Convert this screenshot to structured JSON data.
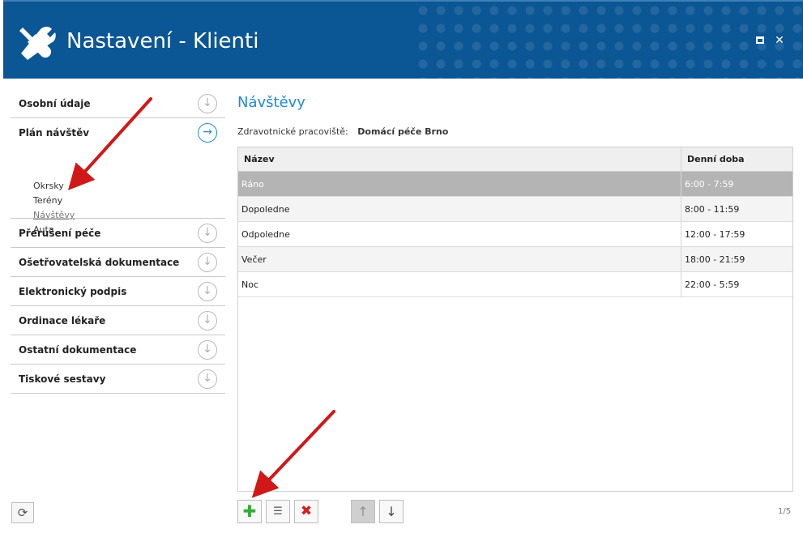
{
  "window": {
    "title": "Nastavení - Klienti"
  },
  "sidebar": {
    "sections": [
      {
        "label": "Osobní údaje"
      },
      {
        "label": "Plán návštěv",
        "subitems": [
          "Okrsky",
          "Terény",
          "Návštěvy",
          "Auta"
        ]
      },
      {
        "label": "Přerušení péče"
      },
      {
        "label": "Ošetřovatelská dokumentace"
      },
      {
        "label": "Elektronický podpis"
      },
      {
        "label": "Ordinace lékaře"
      },
      {
        "label": "Ostatní dokumentace"
      },
      {
        "label": "Tiskové sestavy"
      }
    ]
  },
  "main": {
    "title": "Návštěvy",
    "workplace_label": "Zdravotnické pracoviště:",
    "workplace_value": "Domácí péče Brno",
    "columns": [
      "Název",
      "Denní doba"
    ],
    "rows": [
      [
        "Ráno",
        "6:00 - 7:59"
      ],
      [
        "Dopoledne",
        "8:00 - 11:59"
      ],
      [
        "Odpoledne",
        "12:00 - 17:59"
      ],
      [
        "Večer",
        "18:00 - 21:59"
      ],
      [
        "Noc",
        "22:00 - 5:59"
      ]
    ],
    "pager": "1/5"
  },
  "toolbar": {
    "add_icon": "✚",
    "edit_icon": "☰",
    "delete_icon": "✖",
    "up_icon": "↑",
    "down_icon": "↓",
    "refresh_icon": "⟳"
  },
  "colors": {
    "header_bg": "#0b5694",
    "accent": "#1e8ad6",
    "selected_row": "#b4b4b4",
    "annotation_arrow": "#d01818"
  }
}
